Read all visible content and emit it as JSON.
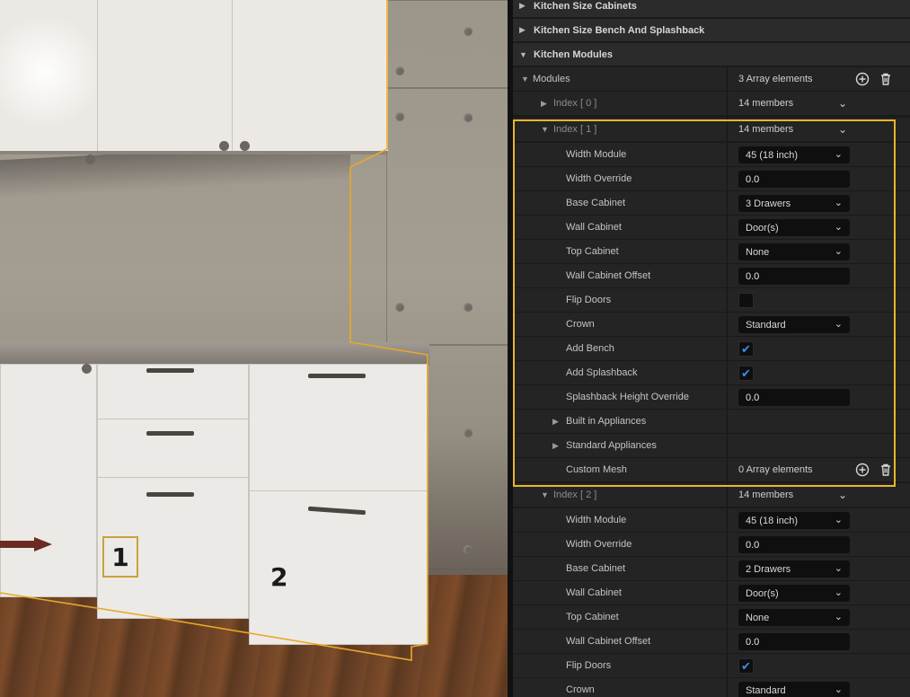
{
  "viewport": {
    "annotation_1": "1",
    "annotation_2": "2"
  },
  "details": {
    "sections": [
      {
        "label": "Kitchen Size Cabinets",
        "expanded": false
      },
      {
        "label": "Kitchen Size Bench And Splashback",
        "expanded": false
      },
      {
        "label": "Kitchen Modules",
        "expanded": true
      }
    ],
    "modules": {
      "label": "Modules",
      "value": "3 Array elements"
    },
    "index0": {
      "label": "Index [ 0 ]",
      "value": "14 members"
    },
    "index1": {
      "label": "Index [ 1 ]",
      "value": "14 members",
      "width_module": {
        "label": "Width Module",
        "value": "45 (18 inch)"
      },
      "width_override": {
        "label": "Width Override",
        "value": "0.0"
      },
      "base_cabinet": {
        "label": "Base Cabinet",
        "value": "3 Drawers"
      },
      "wall_cabinet": {
        "label": "Wall Cabinet",
        "value": "Door(s)"
      },
      "top_cabinet": {
        "label": "Top Cabinet",
        "value": "None"
      },
      "wall_cabinet_offset": {
        "label": "Wall Cabinet Offset",
        "value": "0.0"
      },
      "flip_doors": {
        "label": "Flip Doors",
        "checked": false
      },
      "crown": {
        "label": "Crown",
        "value": "Standard"
      },
      "add_bench": {
        "label": "Add Bench",
        "checked": true
      },
      "add_splashback": {
        "label": "Add Splashback",
        "checked": true
      },
      "splashback_height_override": {
        "label": "Splashback Height Override",
        "value": "0.0"
      },
      "built_in_appliances": {
        "label": "Built in Appliances"
      },
      "standard_appliances": {
        "label": "Standard Appliances"
      },
      "custom_mesh": {
        "label": "Custom Mesh",
        "value": "0 Array elements"
      }
    },
    "index2": {
      "label": "Index [ 2 ]",
      "value": "14 members",
      "width_module": {
        "label": "Width Module",
        "value": "45 (18 inch)"
      },
      "width_override": {
        "label": "Width Override",
        "value": "0.0"
      },
      "base_cabinet": {
        "label": "Base Cabinet",
        "value": "2 Drawers"
      },
      "wall_cabinet": {
        "label": "Wall Cabinet",
        "value": "Door(s)"
      },
      "top_cabinet": {
        "label": "Top Cabinet",
        "value": "None"
      },
      "wall_cabinet_offset": {
        "label": "Wall Cabinet Offset",
        "value": "0.0"
      },
      "flip_doors": {
        "label": "Flip Doors",
        "checked": true
      },
      "crown": {
        "label": "Crown",
        "value": "Standard"
      }
    },
    "colors": {
      "selection_highlight": "#e9b52a",
      "checkbox_accent": "#3a8ee6"
    }
  }
}
